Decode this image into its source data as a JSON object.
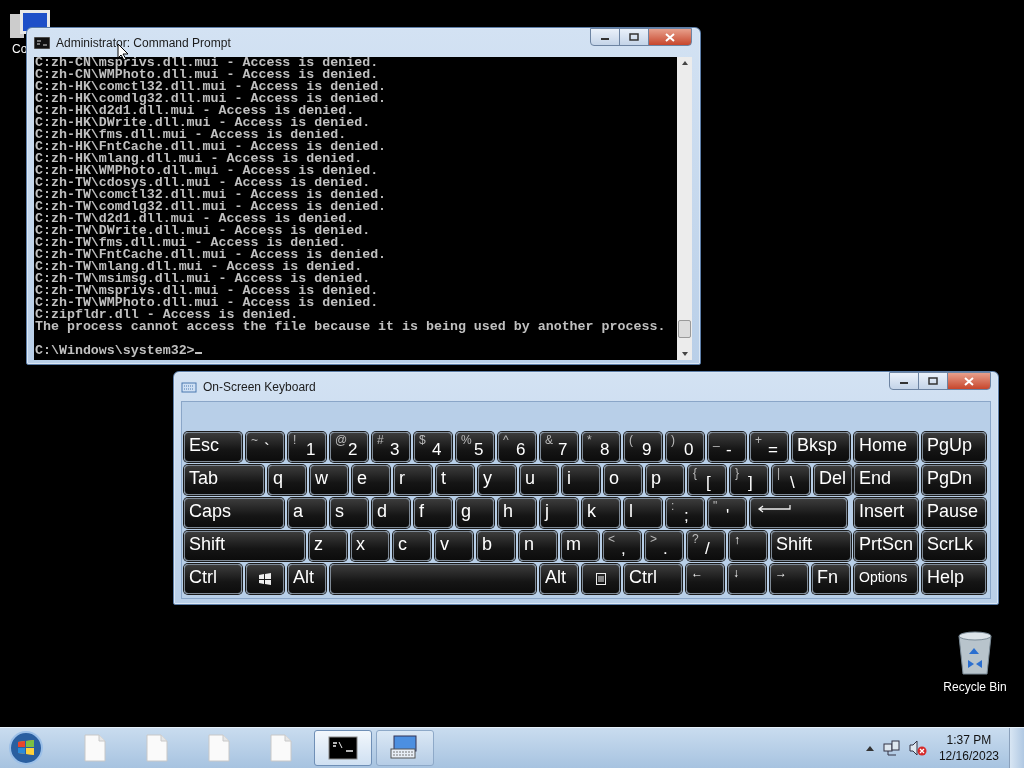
{
  "desktop": {
    "icons": [
      {
        "kind": "computer",
        "label": "Co"
      },
      {
        "kind": "recycle-bin",
        "label": "Recycle Bin"
      }
    ]
  },
  "console": {
    "title": "Administrator:  Command Prompt",
    "lines": [
      "C:zh-CN\\msprivs.dll.mui - Access is denied.",
      "C:zh-CN\\WMPhoto.dll.mui - Access is denied.",
      "C:zh-HK\\comctl32.dll.mui - Access is denied.",
      "C:zh-HK\\comdlg32.dll.mui - Access is denied.",
      "C:zh-HK\\d2d1.dll.mui - Access is denied.",
      "C:zh-HK\\DWrite.dll.mui - Access is denied.",
      "C:zh-HK\\fms.dll.mui - Access is denied.",
      "C:zh-HK\\FntCache.dll.mui - Access is denied.",
      "C:zh-HK\\mlang.dll.mui - Access is denied.",
      "C:zh-HK\\WMPhoto.dll.mui - Access is denied.",
      "C:zh-TW\\cdosys.dll.mui - Access is denied.",
      "C:zh-TW\\comctl32.dll.mui - Access is denied.",
      "C:zh-TW\\comdlg32.dll.mui - Access is denied.",
      "C:zh-TW\\d2d1.dll.mui - Access is denied.",
      "C:zh-TW\\DWrite.dll.mui - Access is denied.",
      "C:zh-TW\\fms.dll.mui - Access is denied.",
      "C:zh-TW\\FntCache.dll.mui - Access is denied.",
      "C:zh-TW\\mlang.dll.mui - Access is denied.",
      "C:zh-TW\\msimsg.dll.mui - Access is denied.",
      "C:zh-TW\\msprivs.dll.mui - Access is denied.",
      "C:zh-TW\\WMPhoto.dll.mui - Access is denied.",
      "C:zipfldr.dll - Access is denied.",
      "The process cannot access the file because it is being used by another process."
    ],
    "prompt": "C:\\Windows\\system32>"
  },
  "keyboard": {
    "title": "On-Screen Keyboard",
    "rows": [
      {
        "main": [
          {
            "kind": "label",
            "label": "Esc"
          },
          {
            "kind": "dual",
            "top": "~",
            "label": "`"
          },
          {
            "kind": "dual",
            "top": "!",
            "label": "1"
          },
          {
            "kind": "dual",
            "top": "@",
            "label": "2"
          },
          {
            "kind": "dual",
            "top": "#",
            "label": "3"
          },
          {
            "kind": "dual",
            "top": "$",
            "label": "4"
          },
          {
            "kind": "dual",
            "top": "%",
            "label": "5"
          },
          {
            "kind": "dual",
            "top": "^",
            "label": "6"
          },
          {
            "kind": "dual",
            "top": "&",
            "label": "7"
          },
          {
            "kind": "dual",
            "top": "*",
            "label": "8"
          },
          {
            "kind": "dual",
            "top": "(",
            "label": "9"
          },
          {
            "kind": "dual",
            "top": ")",
            "label": "0"
          },
          {
            "kind": "dual",
            "top": "_",
            "label": "-"
          },
          {
            "kind": "dual",
            "top": "+",
            "label": "="
          },
          {
            "kind": "label",
            "label": "Bksp"
          }
        ],
        "nav": [
          {
            "kind": "label",
            "label": "Home"
          },
          {
            "kind": "label",
            "label": "PgUp"
          }
        ]
      },
      {
        "main": [
          {
            "kind": "label",
            "label": "Tab"
          },
          {
            "kind": "label",
            "label": "q"
          },
          {
            "kind": "label",
            "label": "w"
          },
          {
            "kind": "label",
            "label": "e"
          },
          {
            "kind": "label",
            "label": "r"
          },
          {
            "kind": "label",
            "label": "t"
          },
          {
            "kind": "label",
            "label": "y"
          },
          {
            "kind": "label",
            "label": "u"
          },
          {
            "kind": "label",
            "label": "i"
          },
          {
            "kind": "label",
            "label": "o"
          },
          {
            "kind": "label",
            "label": "p"
          },
          {
            "kind": "dual",
            "top": "{",
            "label": "["
          },
          {
            "kind": "dual",
            "top": "}",
            "label": "]"
          },
          {
            "kind": "dual",
            "top": "|",
            "label": "\\"
          },
          {
            "kind": "label",
            "label": "Del"
          }
        ],
        "nav": [
          {
            "kind": "label",
            "label": "End"
          },
          {
            "kind": "label",
            "label": "PgDn"
          }
        ]
      },
      {
        "main": [
          {
            "kind": "label",
            "label": "Caps"
          },
          {
            "kind": "label",
            "label": "a"
          },
          {
            "kind": "label",
            "label": "s"
          },
          {
            "kind": "label",
            "label": "d"
          },
          {
            "kind": "label",
            "label": "f"
          },
          {
            "kind": "label",
            "label": "g"
          },
          {
            "kind": "label",
            "label": "h"
          },
          {
            "kind": "label",
            "label": "j"
          },
          {
            "kind": "label",
            "label": "k"
          },
          {
            "kind": "label",
            "label": "l"
          },
          {
            "kind": "dual",
            "top": ":",
            "label": ";"
          },
          {
            "kind": "dual",
            "top": "\"",
            "label": "'"
          },
          {
            "kind": "enter"
          }
        ],
        "nav": [
          {
            "kind": "label",
            "label": "Insert"
          },
          {
            "kind": "label",
            "label": "Pause"
          }
        ]
      },
      {
        "main": [
          {
            "kind": "label",
            "label": "Shift"
          },
          {
            "kind": "label",
            "label": "z"
          },
          {
            "kind": "label",
            "label": "x"
          },
          {
            "kind": "label",
            "label": "c"
          },
          {
            "kind": "label",
            "label": "v"
          },
          {
            "kind": "label",
            "label": "b"
          },
          {
            "kind": "label",
            "label": "n"
          },
          {
            "kind": "label",
            "label": "m"
          },
          {
            "kind": "dual",
            "top": "<",
            "label": ","
          },
          {
            "kind": "dual",
            "top": ">",
            "label": "."
          },
          {
            "kind": "dual",
            "top": "?",
            "label": "/"
          },
          {
            "kind": "arrow",
            "label": "↑"
          },
          {
            "kind": "label",
            "label": "Shift"
          }
        ],
        "nav": [
          {
            "kind": "label",
            "label": "PrtScn"
          },
          {
            "kind": "label",
            "label": "ScrLk"
          }
        ]
      },
      {
        "main": [
          {
            "kind": "label",
            "label": "Ctrl"
          },
          {
            "kind": "start"
          },
          {
            "kind": "label",
            "label": "Alt"
          },
          {
            "kind": "space"
          },
          {
            "kind": "label",
            "label": "Alt"
          },
          {
            "kind": "menu"
          },
          {
            "kind": "label",
            "label": "Ctrl"
          },
          {
            "kind": "arrow",
            "label": "←"
          },
          {
            "kind": "arrow",
            "label": "↓"
          },
          {
            "kind": "arrow",
            "label": "→"
          },
          {
            "kind": "label",
            "label": "Fn"
          }
        ],
        "nav": [
          {
            "kind": "small",
            "label": "Options"
          },
          {
            "kind": "label",
            "label": "Help"
          }
        ]
      }
    ]
  },
  "taskbar": {
    "items": [
      {
        "kind": "document",
        "running": false,
        "selected": false
      },
      {
        "kind": "document",
        "running": false,
        "selected": false
      },
      {
        "kind": "document",
        "running": false,
        "selected": false
      },
      {
        "kind": "document",
        "running": false,
        "selected": false
      },
      {
        "kind": "console",
        "running": true,
        "selected": true
      },
      {
        "kind": "keyboard",
        "running": true,
        "selected": false
      }
    ],
    "clock": {
      "time": "1:37 PM",
      "date": "12/16/2023"
    }
  }
}
